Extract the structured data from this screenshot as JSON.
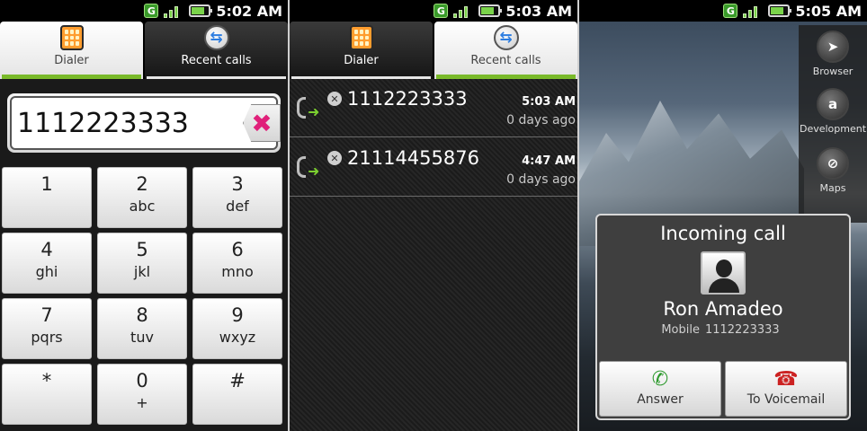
{
  "screens": {
    "dialer": {
      "status_time": "5:02 AM",
      "status_network": "G",
      "tabs": [
        {
          "label": "Dialer",
          "active": true,
          "icon": "dialpad-icon"
        },
        {
          "label": "Recent calls",
          "active": false,
          "icon": "recent-calls-icon"
        }
      ],
      "number": "1112223333",
      "keys": [
        {
          "digit": "1",
          "letters": ""
        },
        {
          "digit": "2",
          "letters": "abc"
        },
        {
          "digit": "3",
          "letters": "def"
        },
        {
          "digit": "4",
          "letters": "ghi"
        },
        {
          "digit": "5",
          "letters": "jkl"
        },
        {
          "digit": "6",
          "letters": "mno"
        },
        {
          "digit": "7",
          "letters": "pqrs"
        },
        {
          "digit": "8",
          "letters": "tuv"
        },
        {
          "digit": "9",
          "letters": "wxyz"
        },
        {
          "digit": "*",
          "letters": ""
        },
        {
          "digit": "0",
          "letters": "+"
        },
        {
          "digit": "#",
          "letters": ""
        }
      ],
      "delete_icon": "delete-x-icon",
      "delete_symbol": "✖",
      "delete_color": "#e0207a"
    },
    "recent": {
      "status_time": "5:03 AM",
      "status_network": "G",
      "tabs": [
        {
          "label": "Dialer",
          "active": false,
          "icon": "dialpad-icon"
        },
        {
          "label": "Recent calls",
          "active": true,
          "icon": "recent-calls-icon"
        }
      ],
      "calls": [
        {
          "number": "1112223333",
          "time": "5:03 AM",
          "ago": "0 days ago",
          "type": "outgoing"
        },
        {
          "number": "21114455876",
          "time": "4:47 AM",
          "ago": "0 days ago",
          "type": "outgoing"
        }
      ]
    },
    "incoming": {
      "status_time": "5:05 AM",
      "status_network": "G",
      "launcher": [
        {
          "label": "Browser",
          "icon": "browser-icon",
          "symbol": "➤"
        },
        {
          "label": "Development",
          "icon": "development-icon",
          "symbol": "a"
        },
        {
          "label": "Maps",
          "icon": "maps-icon",
          "symbol": "⊘"
        }
      ],
      "dialog": {
        "title": "Incoming call",
        "name": "Ron Amadeo",
        "label": "Mobile",
        "number": "1112223333",
        "answer_label": "Answer",
        "voicemail_label": "To Voicemail",
        "answer_icon": "phone-green-icon",
        "voicemail_icon": "phone-red-icon",
        "answer_color": "#2e9a2e",
        "voicemail_color": "#cc2222"
      }
    }
  },
  "colors": {
    "accent_green": "#7aba2a",
    "status_green": "#7ad34a"
  }
}
